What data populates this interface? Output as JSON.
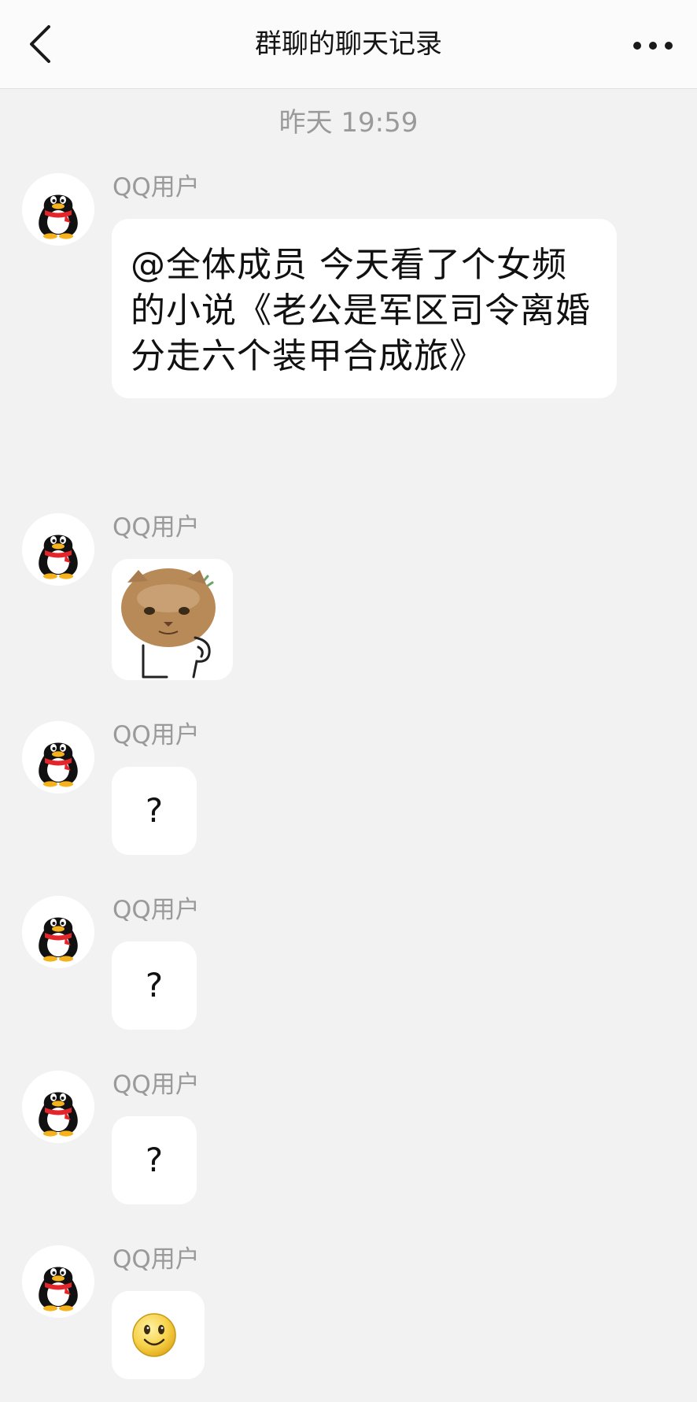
{
  "header": {
    "back_icon": "chevron-left-icon",
    "title": "群聊的聊天记录",
    "more_icon": "more-dots-icon"
  },
  "timestamp": "昨天 19:59",
  "messages": [
    {
      "sender": "QQ用户",
      "avatar": "qq-penguin-icon",
      "type": "text",
      "text": "@全体成员 今天看了个女频的小说《老公是军区司令离婚分走六个装甲合成旅》"
    },
    {
      "sender": "QQ用户",
      "avatar": "qq-penguin-icon",
      "type": "sticker",
      "sticker": "cat-face-thinking-sticker"
    },
    {
      "sender": "QQ用户",
      "avatar": "qq-penguin-icon",
      "type": "text",
      "text": "?"
    },
    {
      "sender": "QQ用户",
      "avatar": "qq-penguin-icon",
      "type": "text",
      "text": "?"
    },
    {
      "sender": "QQ用户",
      "avatar": "qq-penguin-icon",
      "type": "text",
      "text": "?"
    },
    {
      "sender": "QQ用户",
      "avatar": "qq-penguin-icon",
      "type": "emoji",
      "emoji": "smiley-face-icon"
    }
  ],
  "colors": {
    "background": "#f2f2f3",
    "header_bg": "#fbfbfb",
    "bubble_bg": "#ffffff",
    "muted_text": "#9a9a9a",
    "penguin_scarf": "#e3262b",
    "penguin_beak": "#f6b21a"
  }
}
